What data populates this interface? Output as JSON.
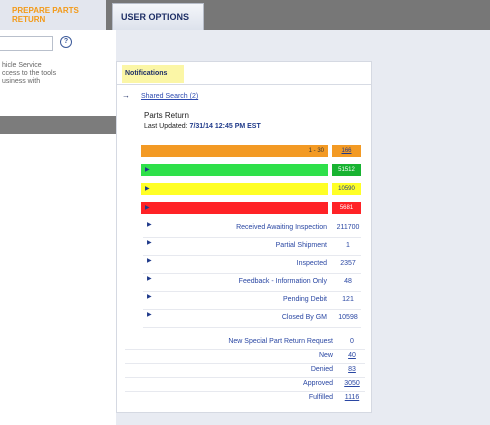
{
  "tabs": {
    "prepare_line1": "PREPARE PARTS",
    "prepare_line2": "RETURN",
    "user_options": "USER OPTIONS"
  },
  "left": {
    "help": "?",
    "description": "hicle Service\nccess to the tools\nusiness with"
  },
  "notifications": {
    "tab_label": "Notifications",
    "shared_search": "Shared Search (2)",
    "title": "Parts Return",
    "last_updated_label": "Last Updated:",
    "last_updated_value": "7/31/14 12:45 PM EST",
    "bars": [
      {
        "label": "1 - 30",
        "count": "166",
        "color": "#f39a24",
        "count_color": "#f39a24"
      },
      {
        "label": "",
        "count": "51512",
        "color": "#2ee04a",
        "count_color": "#18b331"
      },
      {
        "label": "",
        "count": "10590",
        "color": "#ffff26",
        "count_color": "#ffff26"
      },
      {
        "label": "",
        "count": "5681",
        "color": "#ff2226",
        "count_color": "#ff2226"
      }
    ],
    "status_rows": [
      {
        "label": "Received Awaiting Inspection",
        "value": "211700"
      },
      {
        "label": "Partial Shipment",
        "value": "1"
      },
      {
        "label": "Inspected",
        "value": "2357"
      },
      {
        "label": "Feedback - Information Only",
        "value": "48"
      },
      {
        "label": "Pending Debit",
        "value": "121"
      },
      {
        "label": "Closed By GM",
        "value": "10598"
      }
    ],
    "special_rows": [
      {
        "label": "New Special Part Return Request",
        "value": "0",
        "link": false
      },
      {
        "label": "New",
        "value": "40",
        "link": true
      },
      {
        "label": "Denied",
        "value": "83",
        "link": true
      },
      {
        "label": "Approved",
        "value": "3050",
        "link": true
      },
      {
        "label": "Fulfilled",
        "value": "1116",
        "link": true
      }
    ]
  }
}
